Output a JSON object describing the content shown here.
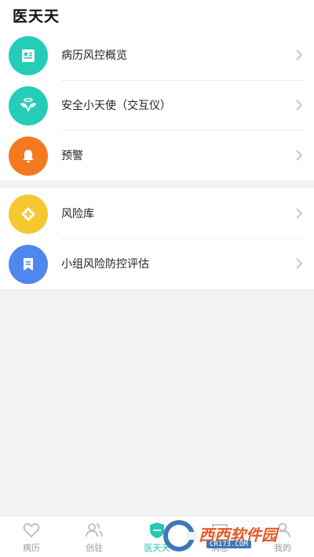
{
  "header": {
    "title": "医天天"
  },
  "group1": [
    {
      "label": "病历风控概览",
      "icon": "document-icon",
      "color": "#25cdb8"
    },
    {
      "label": "安全小天使（交互仪）",
      "icon": "angel-icon",
      "color": "#25cdb8"
    },
    {
      "label": "预警",
      "icon": "bell-icon",
      "color": "#f47a22"
    }
  ],
  "group2": [
    {
      "label": "风险库",
      "icon": "plus-cross-icon",
      "color": "#f7c731"
    },
    {
      "label": "小组风险防控评估",
      "icon": "bookmark-icon",
      "color": "#4f87ee"
    }
  ],
  "tabbar": {
    "tabs": [
      {
        "label": "病历",
        "icon": "heart-icon",
        "active": false
      },
      {
        "label": "创驻",
        "icon": "people-icon",
        "active": false
      },
      {
        "label": "医天天",
        "icon": "shield-icon",
        "active": true
      },
      {
        "label": "消息",
        "icon": "message-icon",
        "active": false
      },
      {
        "label": "我的",
        "icon": "person-icon",
        "active": false
      }
    ]
  },
  "watermark": {
    "text": "西西软件园",
    "sub": "CR173.COM"
  },
  "colors": {
    "accent": "#26c6b3",
    "background": "#f2f2f2"
  }
}
